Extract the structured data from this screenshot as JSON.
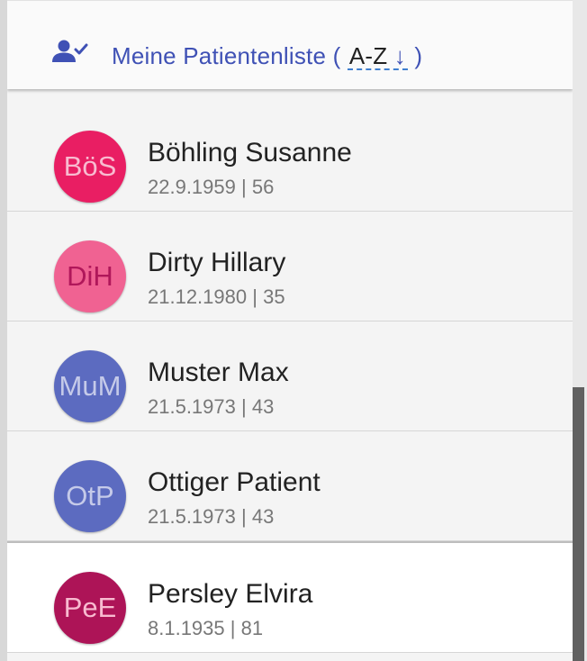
{
  "header": {
    "title_prefix": "Meine Patientenliste (",
    "sort_label": "A-Z",
    "sort_arrow": "↓",
    "title_suffix": ")",
    "icon": "person-check-icon"
  },
  "patients": [
    {
      "initials": "BöS",
      "name": "Böhling Susanne",
      "dob": "22.9.1959",
      "separator": "|",
      "age": "56",
      "avatar_color": "#e91e63",
      "initials_color": "#f8bbd0"
    },
    {
      "initials": "DiH",
      "name": "Dirty Hillary",
      "dob": "21.12.1980",
      "separator": "|",
      "age": "35",
      "avatar_color": "#f06292",
      "initials_color": "#b0175a"
    },
    {
      "initials": "MuM",
      "name": "Muster Max",
      "dob": "21.5.1973",
      "separator": "|",
      "age": "43",
      "avatar_color": "#5c6bc0",
      "initials_color": "#c5cae9"
    },
    {
      "initials": "OtP",
      "name": "Ottiger Patient",
      "dob": "21.5.1973",
      "separator": "|",
      "age": "43",
      "avatar_color": "#5c6bc0",
      "initials_color": "#c5cae9"
    },
    {
      "initials": "PeE",
      "name": "Persley Elvira",
      "dob": "8.1.1935",
      "separator": "|",
      "age": "81",
      "avatar_color": "#ad1457",
      "initials_color": "#f8bbd0",
      "selected": true
    }
  ],
  "colors": {
    "accent": "#3f51b5",
    "sort_underline": "#3f7fd0"
  }
}
